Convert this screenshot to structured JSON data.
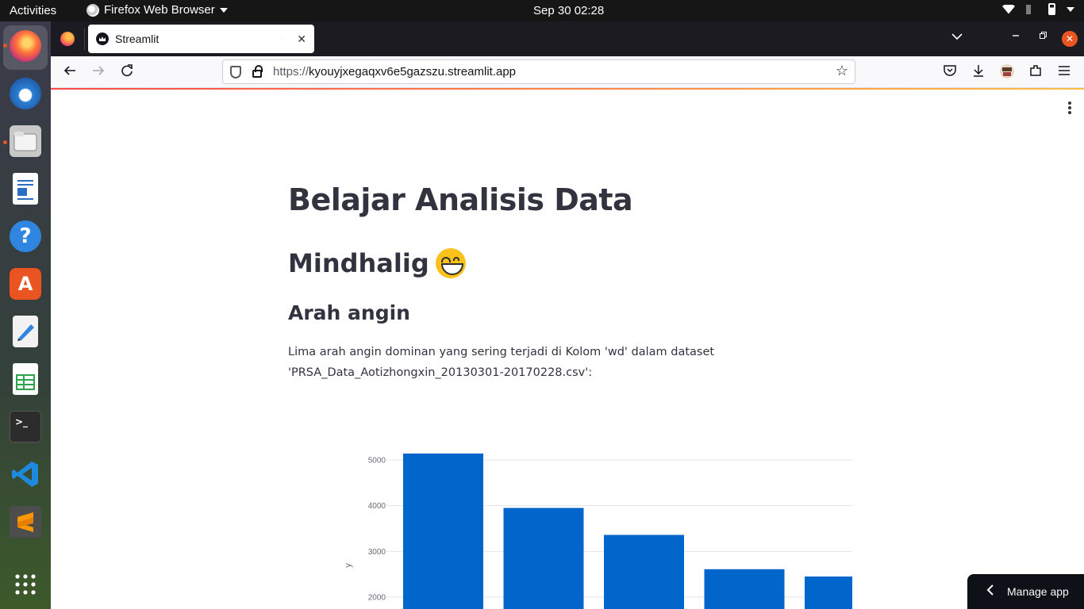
{
  "system_bar": {
    "activities": "Activities",
    "app_name": "Firefox Web Browser",
    "clock": "Sep 30  02:28"
  },
  "dock": {
    "items": [
      {
        "name": "firefox",
        "color": "#ff7139"
      },
      {
        "name": "thunderbird",
        "color": "#2b7fd4"
      },
      {
        "name": "files",
        "color": "#b4b4b4"
      },
      {
        "name": "libreoffice-writer",
        "color": "#2a6fc4"
      },
      {
        "name": "help",
        "color": "#2f86e0"
      },
      {
        "name": "software",
        "color": "#e95420"
      },
      {
        "name": "text-editor",
        "color": "#eeeeee"
      },
      {
        "name": "libreoffice-calc",
        "color": "#2ba34a"
      },
      {
        "name": "terminal",
        "color": "#2c2c2c"
      },
      {
        "name": "vscode",
        "color": "#1d8ae0"
      },
      {
        "name": "sublime-text",
        "color": "#4d4d4d"
      },
      {
        "name": "show-apps",
        "color": "#ffffff"
      }
    ]
  },
  "browser": {
    "tab_title": "Streamlit",
    "url_scheme": "https://",
    "url_host": "kyouyjxegaqxv6e5gazszu.streamlit.app"
  },
  "app": {
    "title": "Belajar Analisis Data",
    "subtitle": "Mindhalig",
    "section": "Arah angin",
    "description": "Lima arah angin dominan yang sering terjadi di Kolom 'wd' dalam dataset 'PRSA_Data_Aotizhongxin_20130301-20170228.csv':",
    "manage_app": "Manage app"
  },
  "chart_data": {
    "type": "bar",
    "ylabel": "y",
    "y_ticks": [
      2000,
      3000,
      4000,
      5000
    ],
    "values": [
      5140,
      3950,
      3360,
      2610,
      2450
    ],
    "color": "#0066cc"
  }
}
